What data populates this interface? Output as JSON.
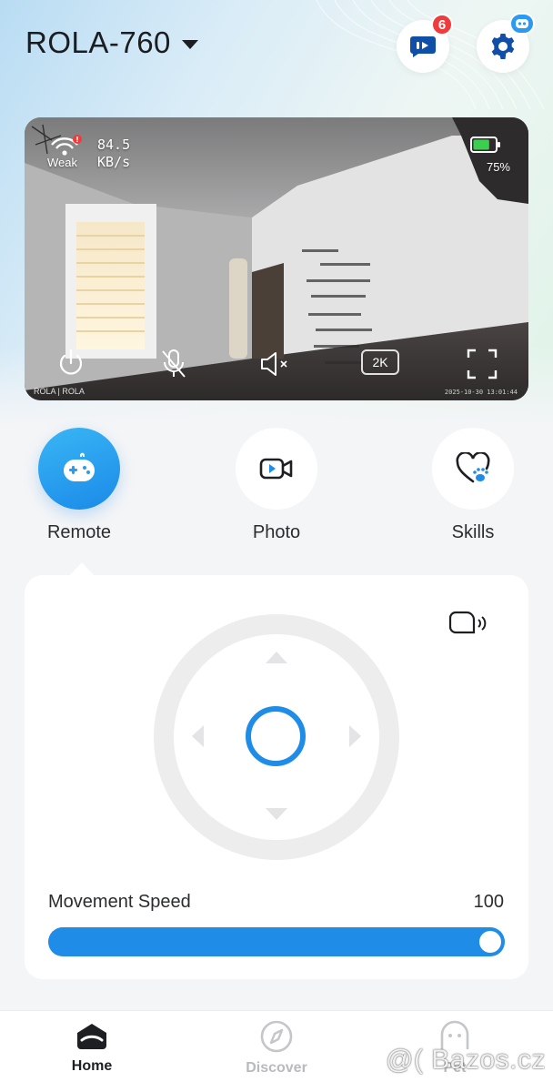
{
  "header": {
    "device_name": "ROLA-760",
    "messages_badge": "6",
    "messages_icon": "video-message-icon",
    "settings_icon": "gear-icon",
    "robot_badge_icon": "robot-face-icon"
  },
  "camera": {
    "signal_label": "Weak",
    "speed_value": "84.5",
    "speed_unit": "KB/s",
    "battery_percent": "75%",
    "battery_level": 0.75,
    "resolution_label": "2K",
    "brand_text": "ROLA | ROLA",
    "timestamp": "2025-10-30 13:01:44",
    "icons": [
      "wifi-icon",
      "battery-icon",
      "power-icon",
      "mic-muted-icon",
      "speaker-muted-icon",
      "fullscreen-icon"
    ]
  },
  "modes": [
    {
      "label": "Remote",
      "icon": "gamepad-icon",
      "active": true
    },
    {
      "label": "Photo",
      "icon": "video-camera-icon",
      "active": false
    },
    {
      "label": "Skills",
      "icon": "heart-paw-icon",
      "active": false
    }
  ],
  "control": {
    "voice_icon": "voice-call-icon",
    "movement_speed_label": "Movement Speed",
    "movement_speed_value": "100",
    "movement_speed_fraction": 1.0
  },
  "tabs": [
    {
      "label": "Home",
      "icon": "home-icon",
      "active": true
    },
    {
      "label": "Discover",
      "icon": "compass-icon",
      "active": false
    },
    {
      "label": "Pet",
      "icon": "pet-icon",
      "active": false
    }
  ],
  "watermark": "@( Bazos.cz",
  "colors": {
    "accent": "#1f8ce8",
    "badge": "#ef3b3b"
  }
}
